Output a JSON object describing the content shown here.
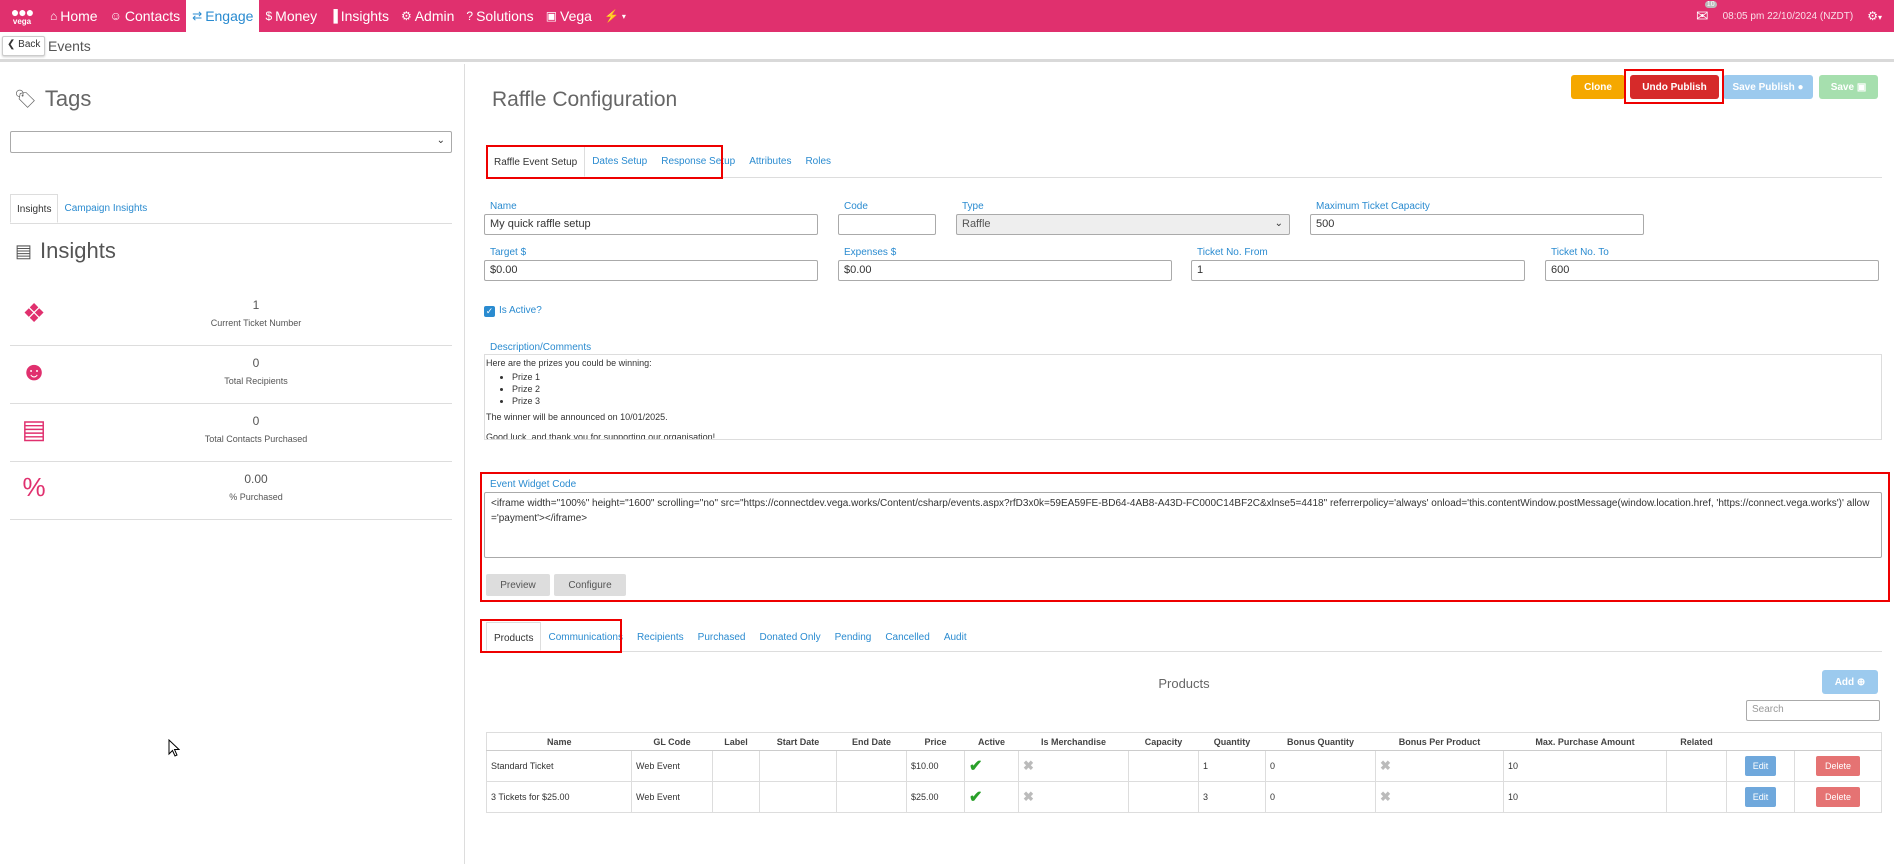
{
  "nav": {
    "logo": "vega",
    "items": [
      {
        "icon": "⌂",
        "label": "Home"
      },
      {
        "icon": "☺",
        "label": "Contacts"
      },
      {
        "icon": "⇄",
        "label": "Engage"
      },
      {
        "icon": "$",
        "label": "Money"
      },
      {
        "icon": "▐",
        "label": "Insights"
      },
      {
        "icon": "⚙",
        "label": "Admin"
      },
      {
        "icon": "?",
        "label": "Solutions"
      },
      {
        "icon": "▣",
        "label": "Vega"
      },
      {
        "icon": "⚡",
        "label": ""
      }
    ],
    "mail_badge": "10",
    "clock": "08:05 pm 22/10/2024 (NZDT)"
  },
  "subbar": {
    "back_label": "Back",
    "breadcrumb": "Events"
  },
  "left": {
    "tags_title": "Tags",
    "tabs": [
      "Insights",
      "Campaign Insights"
    ],
    "insights_title": "Insights",
    "stats": [
      {
        "icon": "ticket-icon",
        "value": "1",
        "label": "Current Ticket Number"
      },
      {
        "icon": "users-icon",
        "value": "0",
        "label": "Total Recipients"
      },
      {
        "icon": "credit-card-icon",
        "value": "0",
        "label": "Total Contacts Purchased"
      },
      {
        "icon": "percent-icon",
        "value": "0.00",
        "label": "% Purchased"
      }
    ]
  },
  "main": {
    "title": "Raffle Configuration",
    "buttons": {
      "clone": "Clone",
      "undo_publish": "Undo Publish",
      "save_publish": "Save Publish",
      "save": "Save"
    },
    "tabs": [
      "Raffle Event Setup",
      "Dates Setup",
      "Response Setup",
      "Attributes",
      "Roles"
    ],
    "fields": {
      "name": {
        "label": "Name",
        "value": "My quick raffle setup"
      },
      "code": {
        "label": "Code",
        "value": ""
      },
      "type": {
        "label": "Type",
        "value": "Raffle"
      },
      "max_capacity": {
        "label": "Maximum Ticket Capacity",
        "value": "500"
      },
      "target": {
        "label": "Target $",
        "value": "$0.00"
      },
      "expenses": {
        "label": "Expenses $",
        "value": "$0.00"
      },
      "ticket_from": {
        "label": "Ticket No. From",
        "value": "1"
      },
      "ticket_to": {
        "label": "Ticket No. To",
        "value": "600"
      }
    },
    "is_active_label": "Is Active?",
    "description_label": "Description/Comments",
    "description": {
      "intro": "Here are the prizes you could be winning:",
      "prizes": [
        "Prize 1",
        "Prize 2",
        "Prize 3"
      ],
      "announce": "The winner will be announced on 10/01/2025.",
      "closing": "Good luck, and thank you for supporting our organisation!"
    },
    "widget_label": "Event Widget Code",
    "widget_code": "<iframe width=\"100%\" height=\"1600\" scrolling=\"no\" src=\"https://connectdev.vega.works/Content/csharp/events.aspx?rfD3x0k=59EA59FE-BD64-4AB8-A43D-FC000C14BF2C&xlnse5=4418\" referrerpolicy='always' onload='this.contentWindow.postMessage(window.location.href, 'https://connect.vega.works')' allow='payment'></iframe>",
    "preview_label": "Preview",
    "configure_label": "Configure",
    "tabs2": [
      "Products",
      "Communications",
      "Recipients",
      "Purchased",
      "Donated Only",
      "Pending",
      "Cancelled",
      "Audit"
    ],
    "products_title": "Products",
    "add_label": "Add",
    "search_placeholder": "Search",
    "table": {
      "headers": [
        "Name",
        "GL Code",
        "Label",
        "Start Date",
        "End Date",
        "Price",
        "Active",
        "Is Merchandise",
        "Capacity",
        "Quantity",
        "Bonus Quantity",
        "Bonus Per Product",
        "Max. Purchase Amount",
        "Related",
        "",
        ""
      ],
      "rows": [
        {
          "name": "Standard Ticket",
          "gl": "Web Event",
          "label": "",
          "start": "",
          "end": "",
          "price": "$10.00",
          "qty": "1",
          "bonus": "0",
          "max": "10",
          "edit": "Edit",
          "delete": "Delete"
        },
        {
          "name": "3 Tickets for $25.00",
          "gl": "Web Event",
          "label": "",
          "start": "",
          "end": "",
          "price": "$25.00",
          "qty": "3",
          "bonus": "0",
          "max": "10",
          "edit": "Edit",
          "delete": "Delete"
        }
      ]
    }
  }
}
